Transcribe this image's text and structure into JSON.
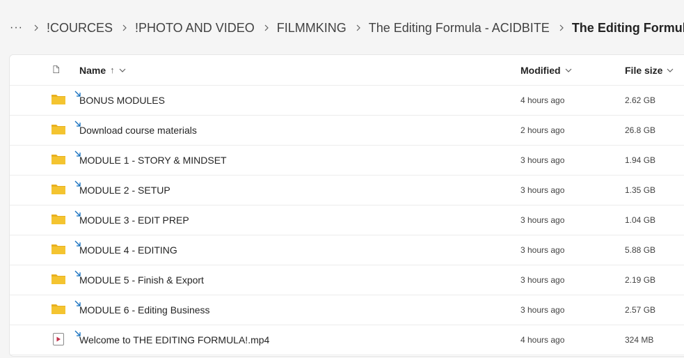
{
  "breadcrumb": {
    "more_label": "···",
    "items": [
      {
        "label": "!COURCES"
      },
      {
        "label": "!PHOTO AND VIDEO"
      },
      {
        "label": "FILMMKING"
      },
      {
        "label": "The Editing Formula - ACIDBITE"
      }
    ],
    "current": "The Editing Formula"
  },
  "columns": {
    "name": "Name",
    "sort_indicator": "↑",
    "modified": "Modified",
    "size": "File size"
  },
  "rows": [
    {
      "name": "BONUS MODULES",
      "type": "folder",
      "modified": "4 hours ago",
      "size": "2.62 GB"
    },
    {
      "name": "Download course materials",
      "type": "folder",
      "modified": "2 hours ago",
      "size": "26.8 GB"
    },
    {
      "name": "MODULE 1 - STORY & MINDSET",
      "type": "folder",
      "modified": "3 hours ago",
      "size": "1.94 GB"
    },
    {
      "name": "MODULE 2 - SETUP",
      "type": "folder",
      "modified": "3 hours ago",
      "size": "1.35 GB"
    },
    {
      "name": "MODULE 3 - EDIT PREP",
      "type": "folder",
      "modified": "3 hours ago",
      "size": "1.04 GB"
    },
    {
      "name": "MODULE 4 - EDITING",
      "type": "folder",
      "modified": "3 hours ago",
      "size": "5.88 GB"
    },
    {
      "name": "MODULE 5 - Finish & Export",
      "type": "folder",
      "modified": "3 hours ago",
      "size": "2.19 GB"
    },
    {
      "name": "MODULE 6 - Editing Business",
      "type": "folder",
      "modified": "3 hours ago",
      "size": "2.57 GB"
    },
    {
      "name": "Welcome to THE EDITING FORMULA!.mp4",
      "type": "video",
      "modified": "4 hours ago",
      "size": "324 MB"
    }
  ],
  "colors": {
    "folder": "#f4c430",
    "folder_tab": "#e8b020",
    "sync": "#0f6cbd",
    "video": "#c4314b"
  },
  "icons": {
    "header_type": "document-icon",
    "folder": "folder-icon",
    "video": "video-file-icon",
    "shared": "shared-sync-icon"
  }
}
